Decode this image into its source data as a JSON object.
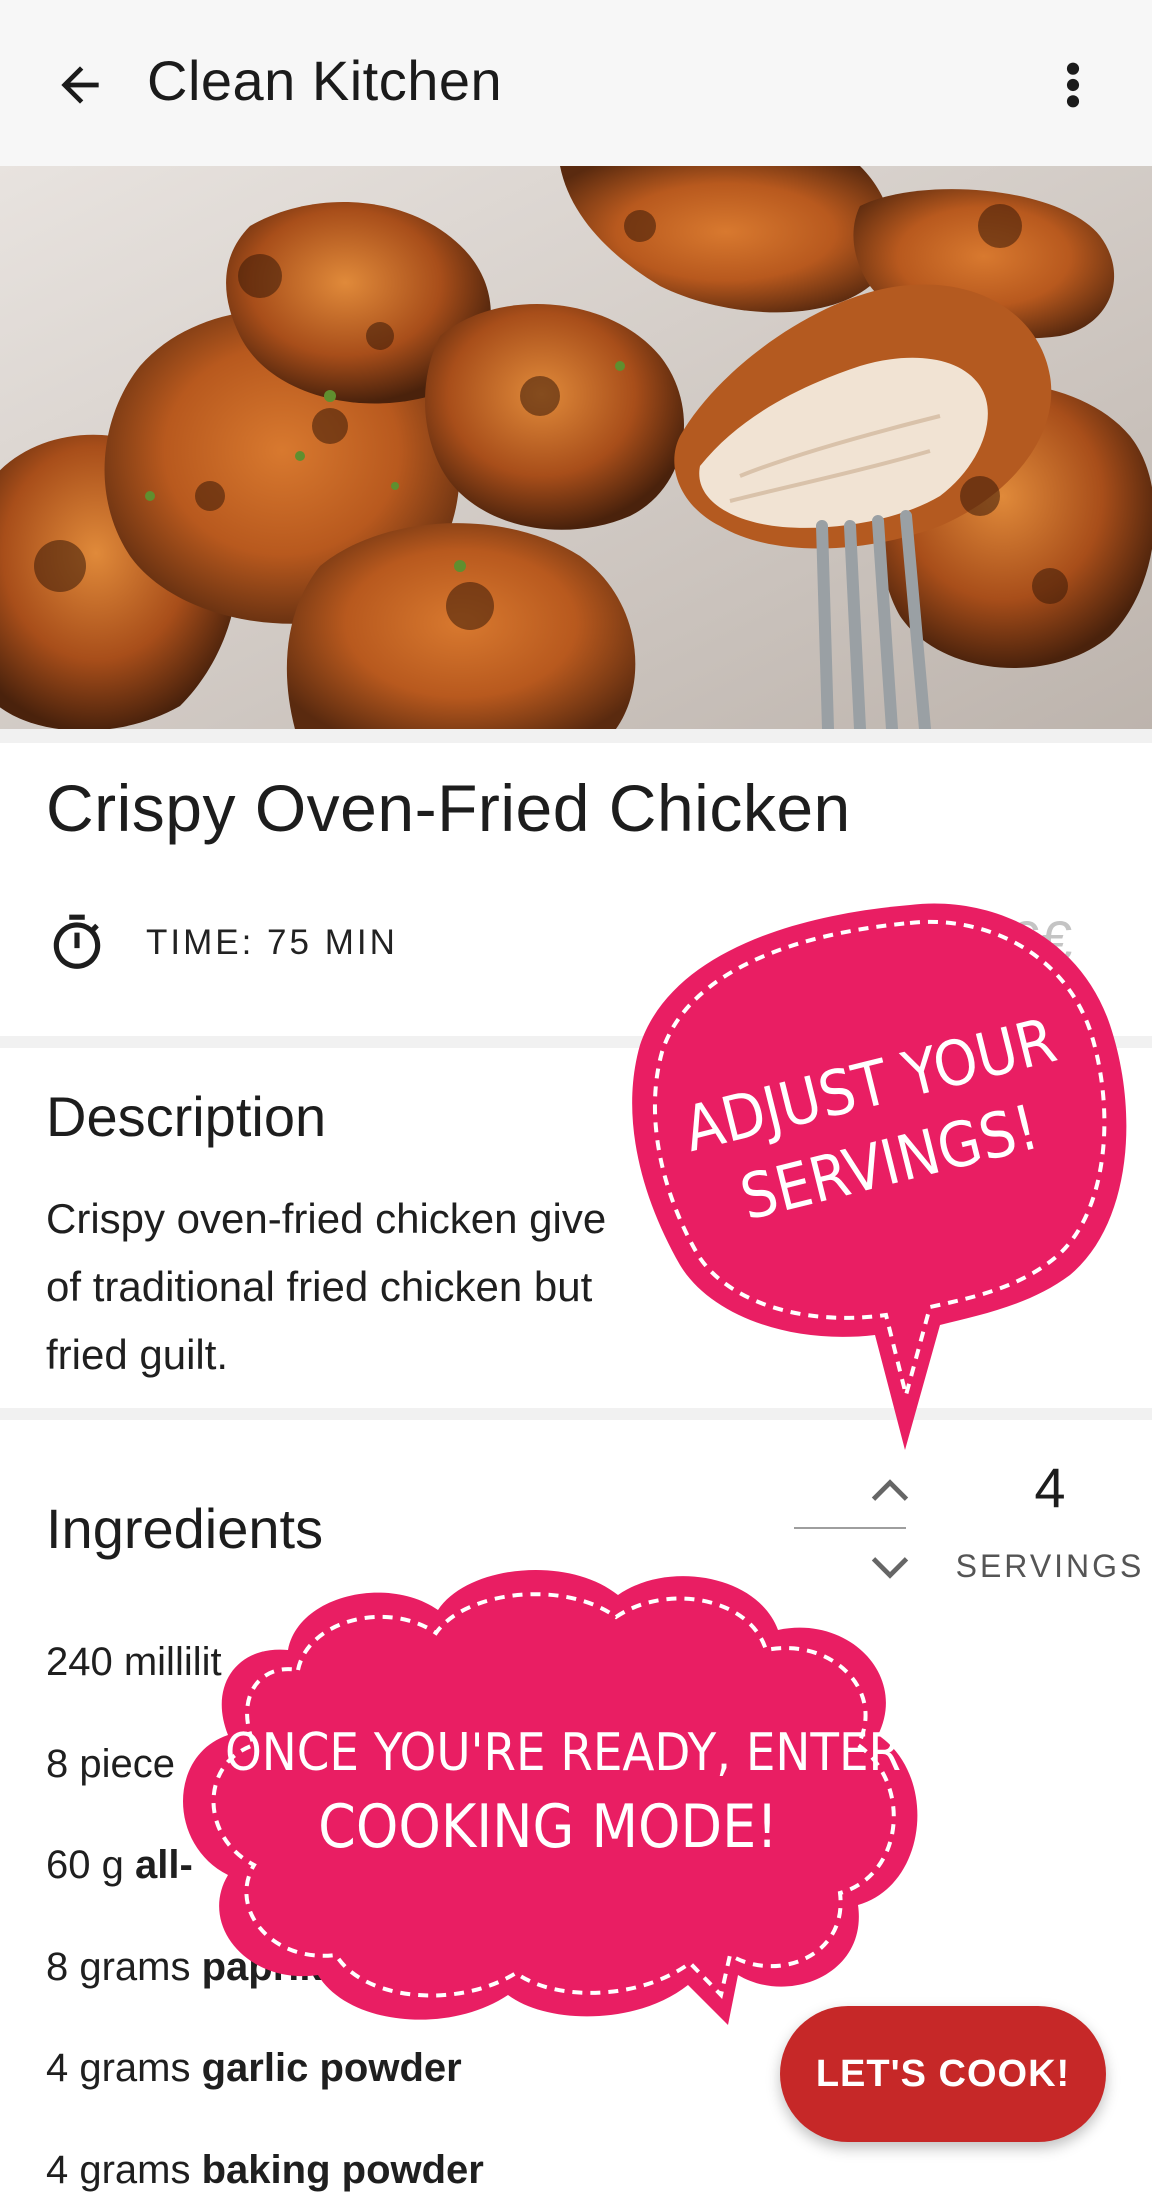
{
  "app_bar": {
    "title": "Clean Kitchen",
    "back_icon": "arrow-left-icon",
    "menu_icon": "more-vertical-icon"
  },
  "hero": {
    "image": "crispy-chicken-photo"
  },
  "recipe": {
    "title": "Crispy Oven-Fried Chicken",
    "time_label": "TIME: 75 MIN",
    "price": "€€"
  },
  "description": {
    "heading": "Description",
    "text_line1": "Crispy oven-fried chicken give",
    "text_line2": "of traditional fried chicken but",
    "text_line3": "fried guilt."
  },
  "ingredients": {
    "heading": "Ingredients",
    "servings_count": "4",
    "servings_label": "SERVINGS",
    "items": [
      {
        "amount": "240 millilit",
        "name": ""
      },
      {
        "amount": "8 piece",
        "name": ""
      },
      {
        "amount": "60 g",
        "name": "all-"
      },
      {
        "amount": "8 grams",
        "name": "paprika"
      },
      {
        "amount": "4 grams",
        "name": "garlic powder"
      },
      {
        "amount": "4 grams",
        "name": "baking powder"
      }
    ]
  },
  "tips": {
    "servings_line1": "ADJUST YOUR",
    "servings_line2": "SERVINGS!",
    "cook_line1": "ONCE YOU'RE READY, ENTER",
    "cook_line2": "COOKING MODE!"
  },
  "fab": {
    "label": "LET'S COOK!"
  },
  "colors": {
    "accent": "#c62828",
    "bubble": "#e91e63"
  }
}
